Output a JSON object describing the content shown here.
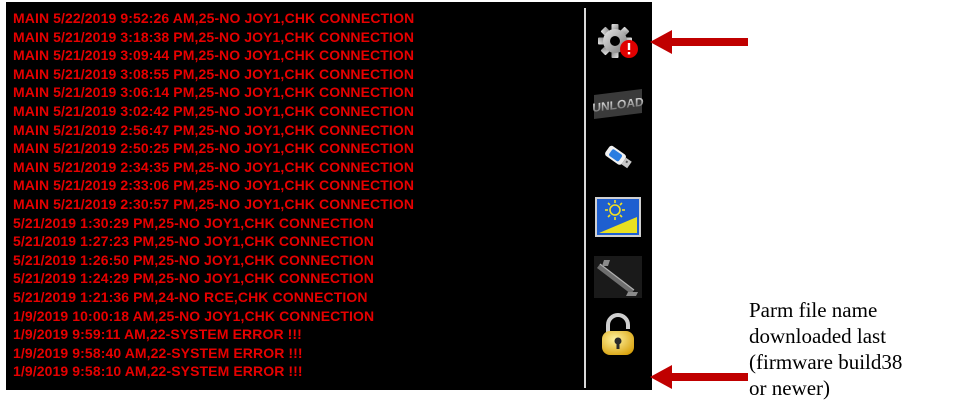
{
  "log": {
    "lines": [
      "MAIN 5/22/2019 9:52:26 AM,25-NO JOY1,CHK CONNECTION",
      "MAIN 5/21/2019 3:18:38 PM,25-NO JOY1,CHK CONNECTION",
      "MAIN 5/21/2019 3:09:44 PM,25-NO JOY1,CHK CONNECTION",
      "MAIN 5/21/2019 3:08:55 PM,25-NO JOY1,CHK CONNECTION",
      "MAIN 5/21/2019 3:06:14 PM,25-NO JOY1,CHK CONNECTION",
      "MAIN 5/21/2019 3:02:42 PM,25-NO JOY1,CHK CONNECTION",
      "MAIN 5/21/2019 2:56:47 PM,25-NO JOY1,CHK CONNECTION",
      "MAIN 5/21/2019 2:50:25 PM,25-NO JOY1,CHK CONNECTION",
      "MAIN 5/21/2019 2:34:35 PM,25-NO JOY1,CHK CONNECTION",
      "MAIN 5/21/2019 2:33:06 PM,25-NO JOY1,CHK CONNECTION",
      "MAIN 5/21/2019 2:30:57 PM,25-NO JOY1,CHK CONNECTION",
      "5/21/2019 1:30:29 PM,25-NO JOY1,CHK CONNECTION",
      "5/21/2019 1:27:23 PM,25-NO JOY1,CHK CONNECTION",
      "5/21/2019 1:26:50 PM,25-NO JOY1,CHK CONNECTION",
      "5/21/2019 1:24:29 PM,25-NO JOY1,CHK CONNECTION",
      "5/21/2019 1:21:36 PM,24-NO RCE,CHK CONNECTION",
      "1/9/2019 10:00:18 AM,25-NO JOY1,CHK CONNECTION",
      "1/9/2019 9:59:11 AM,22-SYSTEM ERROR !!!",
      "1/9/2019 9:58:40 AM,22-SYSTEM ERROR !!!",
      "1/9/2019 9:58:10 AM,22-SYSTEM ERROR !!!"
    ],
    "text_color": "#e60000",
    "background": "#000000"
  },
  "sidebar": {
    "buttons": [
      {
        "name": "settings-alert-button",
        "icon": "gear-alert-icon"
      },
      {
        "name": "unload-button",
        "icon": "unload-icon",
        "label": "UNLOAD"
      },
      {
        "name": "usb-button",
        "icon": "usb-drive-icon"
      },
      {
        "name": "display-brightness-button",
        "icon": "brightness-icon"
      },
      {
        "name": "boom-button",
        "icon": "boom-arm-icon"
      },
      {
        "name": "lock-button",
        "icon": "padlock-icon"
      }
    ]
  },
  "annotations": {
    "arrow_color": "#c00000",
    "note_lines": [
      "Parm file name",
      "downloaded last",
      "(firmware build38",
      "or newer)"
    ]
  }
}
